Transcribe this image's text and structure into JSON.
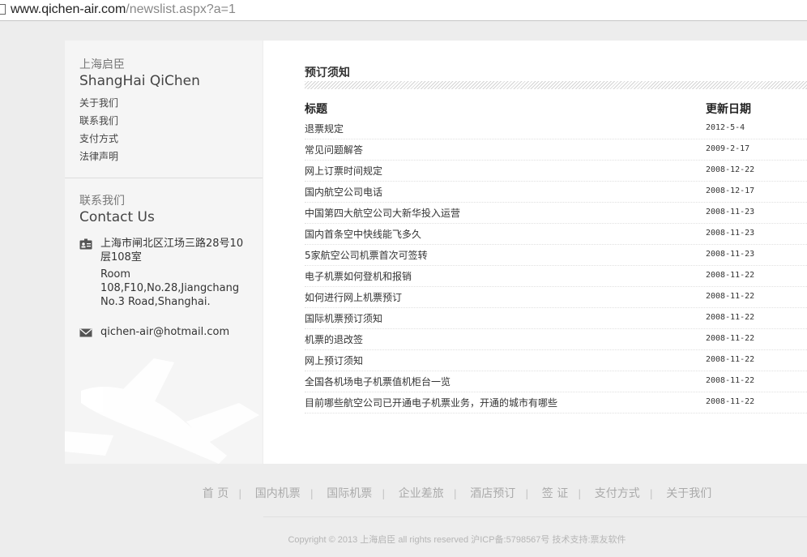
{
  "browser": {
    "url_host": "www.qichen-air.com",
    "url_path": "/newslist.aspx?a=1"
  },
  "sidebar": {
    "about": {
      "title_cn": "上海启臣",
      "title_en": "ShangHai QiChen",
      "links": [
        "关于我们",
        "联系我们",
        "支付方式",
        "法律声明"
      ]
    },
    "contact": {
      "title_cn": "联系我们",
      "title_en": "Contact Us",
      "address_cn": "上海市闸北区江场三路28号10层108室",
      "address_en": "Room 108,F10,No.28,Jiangchang No.3 Road,Shanghai.",
      "email": "qichen-air@hotmail.com"
    }
  },
  "main": {
    "section_title": "预订须知",
    "col_title": "标题",
    "col_date": "更新日期",
    "rows": [
      {
        "title": "退票规定",
        "date": "2012-5-4"
      },
      {
        "title": "常见问题解答",
        "date": "2009-2-17"
      },
      {
        "title": "网上订票时间规定",
        "date": "2008-12-22"
      },
      {
        "title": "国内航空公司电话",
        "date": "2008-12-17"
      },
      {
        "title": "中国第四大航空公司大新华投入运营",
        "date": "2008-11-23"
      },
      {
        "title": "国内首条空中快线能飞多久",
        "date": "2008-11-23"
      },
      {
        "title": "5家航空公司机票首次可签转",
        "date": "2008-11-23"
      },
      {
        "title": "电子机票如何登机和报销",
        "date": "2008-11-22"
      },
      {
        "title": "如何进行网上机票预订",
        "date": "2008-11-22"
      },
      {
        "title": "国际机票预订须知",
        "date": "2008-11-22"
      },
      {
        "title": "机票的退改签",
        "date": "2008-11-22"
      },
      {
        "title": "网上预订须知",
        "date": "2008-11-22"
      },
      {
        "title": "全国各机场电子机票值机柜台一览",
        "date": "2008-11-22"
      },
      {
        "title": "目前哪些航空公司已开通电子机票业务，开通的城市有哪些",
        "date": "2008-11-22"
      }
    ]
  },
  "footer": {
    "nav": [
      "首 页",
      "国内机票",
      "国际机票",
      "企业差旅",
      "酒店预订",
      "签 证",
      "支付方式",
      "关于我们"
    ],
    "separator": "|",
    "copyright": "Copyright © 2013 上海启臣 all rights reserved 沪ICP备:5798567号 技术支持:票友软件"
  },
  "colors": {
    "page_bg": "#ededed",
    "sidebar_bg": "#f5f5f5",
    "content_bg": "#ffffff",
    "footer_text": "#aaaaaa"
  },
  "icons": {
    "address": "id-card-icon",
    "email": "envelope-icon",
    "decoration": "airplane-watermark-icon"
  }
}
